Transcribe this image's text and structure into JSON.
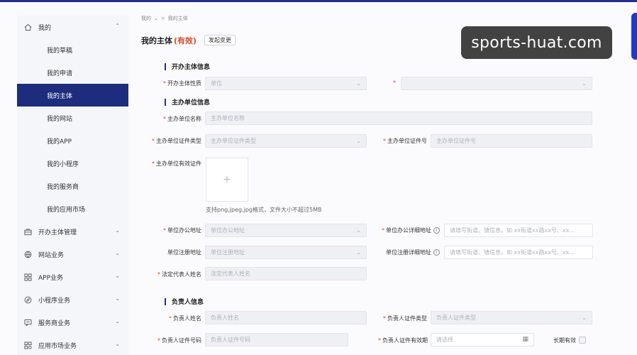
{
  "breadcrumb": {
    "root": "我的",
    "sep": ">",
    "current": "我的主体"
  },
  "page": {
    "title": "我的主体",
    "status": "(有效)",
    "change_button": "发起变更"
  },
  "sidebar": {
    "group_my": "我的",
    "children": [
      "我的草稿",
      "我的申请",
      "我的主体",
      "我的网站",
      "我的APP",
      "我的小程序",
      "我的服务商",
      "我的应用市场"
    ],
    "active_child": "我的主体",
    "groups": [
      "开办主体管理",
      "网站业务",
      "APP业务",
      "小程序业务",
      "服务商业务",
      "应用市场业务"
    ]
  },
  "sections": {
    "open_entity": "开办主体信息",
    "host_unit": "主办单位信息",
    "owner": "负责人信息"
  },
  "form": {
    "entity_nature": {
      "label": "开办主体性质",
      "value": "单位"
    },
    "second_select": {
      "label": "",
      "value": ""
    },
    "unit_name": {
      "label": "主办单位名称",
      "placeholder": "主办单位名称"
    },
    "cert_type": {
      "label": "主办单位证件类型",
      "placeholder": "主办单位证件类型"
    },
    "cert_no": {
      "label": "主办单位证件号",
      "placeholder": "主办单位证件号"
    },
    "valid_cert": {
      "label": "主办单位有效证件",
      "upload_tip": "支持png,jpeg,jpg格式，文件大小不超过5MB"
    },
    "office_addr": {
      "label": "单位办公地址",
      "placeholder": "单位办公地址"
    },
    "office_detail": {
      "label": "单位办公详细地址",
      "placeholder": "请填写街道、镇信息。如 xx街道xx路xx号、xx..."
    },
    "reg_addr": {
      "label": "单位注册地址",
      "placeholder": "单位注册地址"
    },
    "reg_detail": {
      "label": "单位注册详细地址",
      "placeholder": "请填写街道、镇信息。如 xx街道xx路xx号、xx..."
    },
    "legal_rep": {
      "label": "法定代表人姓名",
      "placeholder": "法定代表人姓名"
    },
    "owner_name": {
      "label": "负责人姓名",
      "placeholder": "负责人姓名"
    },
    "owner_cert_type": {
      "label": "负责人证件类型",
      "placeholder": "负责人证件类型"
    },
    "owner_cert_no": {
      "label": "负责人证件号码",
      "placeholder": "负责人证件号码"
    },
    "owner_cert_valid": {
      "label": "负责人证件有效期",
      "placeholder": "请选择"
    },
    "long_term": {
      "label": "长期有效"
    }
  },
  "watermark": "sports-huat.com"
}
